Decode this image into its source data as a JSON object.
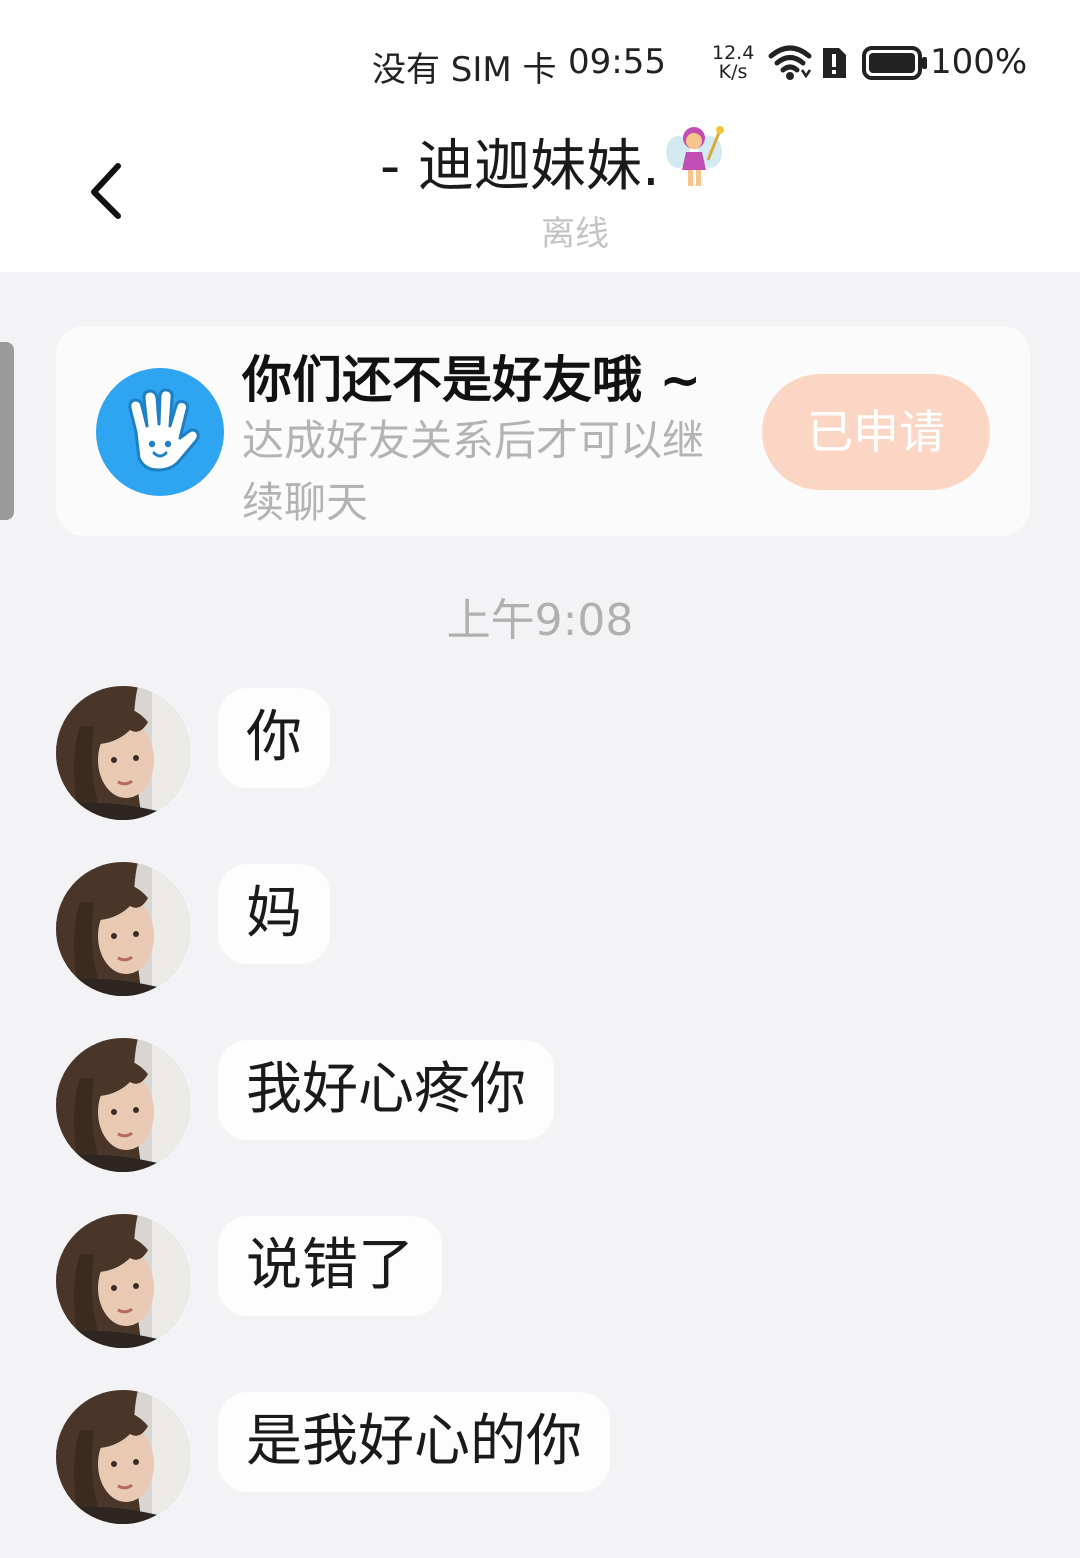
{
  "status_bar": {
    "carrier": "没有 SIM 卡",
    "time": "09:55",
    "speed_top": "12.4",
    "speed_bottom": "K/s",
    "battery": "100%"
  },
  "header": {
    "back_icon": "chevron-left-icon",
    "title": "- 迪迦妹妹.",
    "title_emoji": "fairy-icon",
    "subtitle": "离线"
  },
  "friend_card": {
    "title": "你们还不是好友哦 ~",
    "description": "达成好友关系后才可以继续聊天",
    "button_label": "已申请",
    "icon": "waving-hand-icon",
    "button_color": "#fcd6c4"
  },
  "timestamp": "上午9:08",
  "messages": [
    {
      "text": "你"
    },
    {
      "text": "妈"
    },
    {
      "text": "我好心疼你"
    },
    {
      "text": "说错了"
    },
    {
      "text": "是我好心的你"
    }
  ]
}
